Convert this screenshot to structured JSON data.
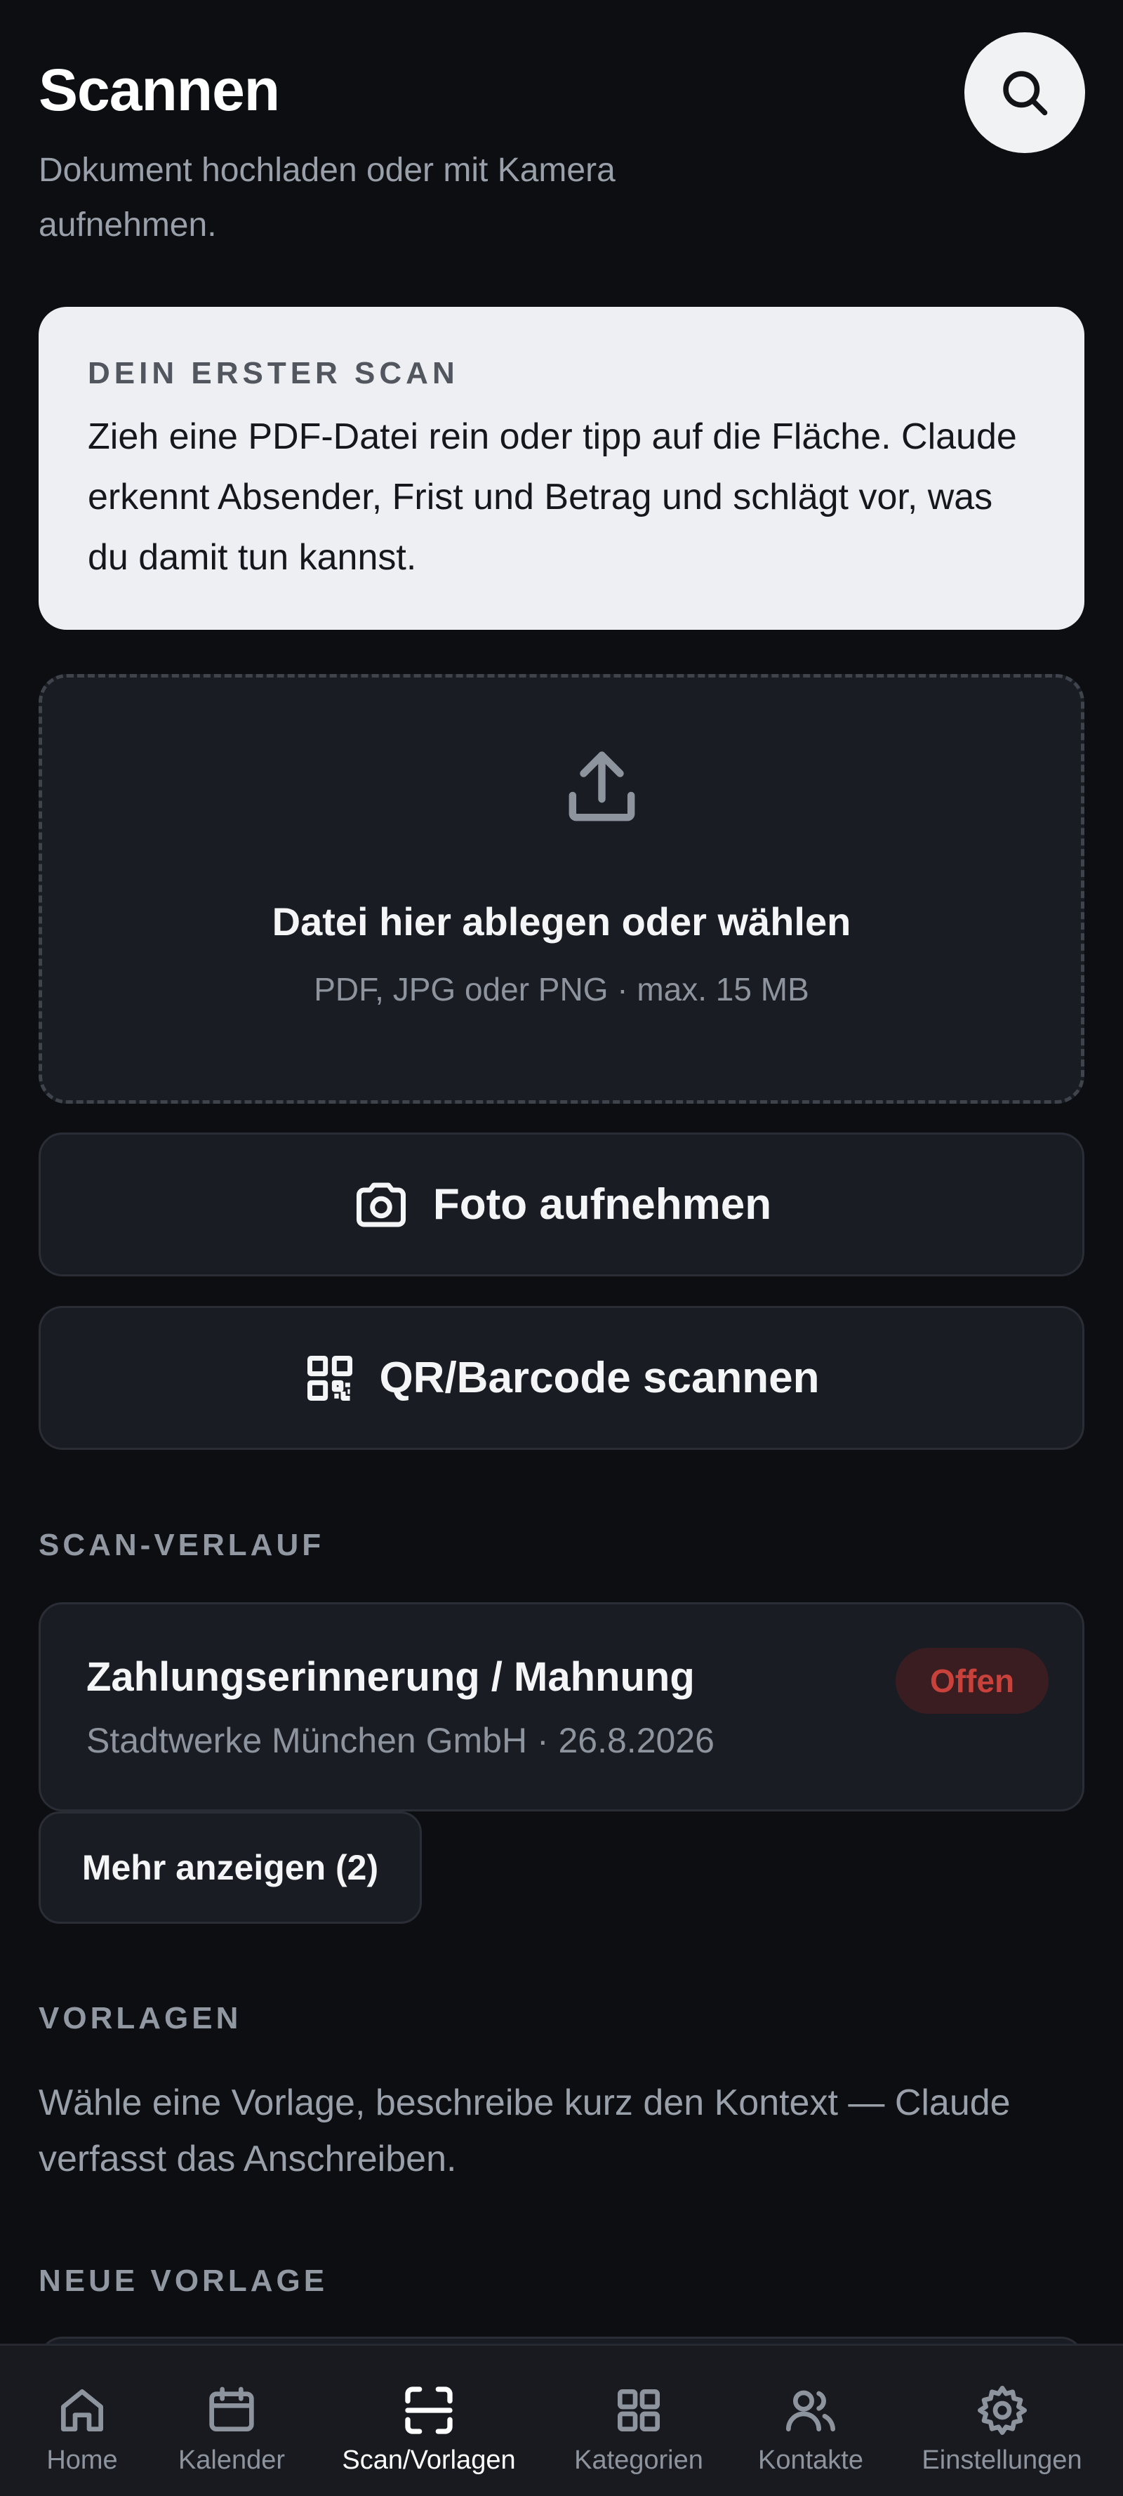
{
  "header": {
    "title": "Scannen",
    "subtitle": "Dokument hochladen oder mit Kamera aufnehmen.",
    "search_icon": "search-icon"
  },
  "onboarding": {
    "eyebrow": "DEIN ERSTER SCAN",
    "text": "Zieh eine PDF-Datei rein oder tipp auf die Fläche. Claude erkennt Absender, Frist und Betrag und schlägt vor, was du damit tun kannst."
  },
  "dropzone": {
    "icon": "upload-icon",
    "title": "Datei hier ablegen oder wählen",
    "hint": "PDF, JPG oder PNG · max. 15 MB"
  },
  "actions": {
    "photo_label": "Foto aufnehmen",
    "photo_icon": "camera-icon",
    "qr_label": "QR/Barcode scannen",
    "qr_icon": "qr-code-icon"
  },
  "history": {
    "heading": "SCAN-VERLAUF",
    "items": [
      {
        "title": "Zahlungserinnerung / Mahnung",
        "meta": "Stadtwerke München GmbH · 26.8.2026",
        "status": "Offen",
        "status_color": "#c8413b"
      }
    ],
    "more_label": "Mehr anzeigen (2)"
  },
  "templates": {
    "heading": "VORLAGEN",
    "text": "Wähle eine Vorlage, beschreibe kurz den Kontext — Claude verfasst das Anschreiben.",
    "new_heading": "NEUE VORLAGE"
  },
  "tabbar": {
    "active": "Scan/Vorlagen",
    "items": [
      {
        "label": "Home",
        "icon": "home-icon"
      },
      {
        "label": "Kalender",
        "icon": "calendar-icon"
      },
      {
        "label": "Scan/Vorlagen",
        "icon": "scan-icon"
      },
      {
        "label": "Kategorien",
        "icon": "grid-icon"
      },
      {
        "label": "Kontakte",
        "icon": "contacts-icon"
      },
      {
        "label": "Einstellungen",
        "icon": "settings-icon"
      }
    ]
  },
  "colors": {
    "background": "#0c0e12",
    "card": "#1a1c23",
    "onboarding_card": "#eeeff2",
    "badge_background": "#3a1d20",
    "badge_text": "#c8413b"
  }
}
